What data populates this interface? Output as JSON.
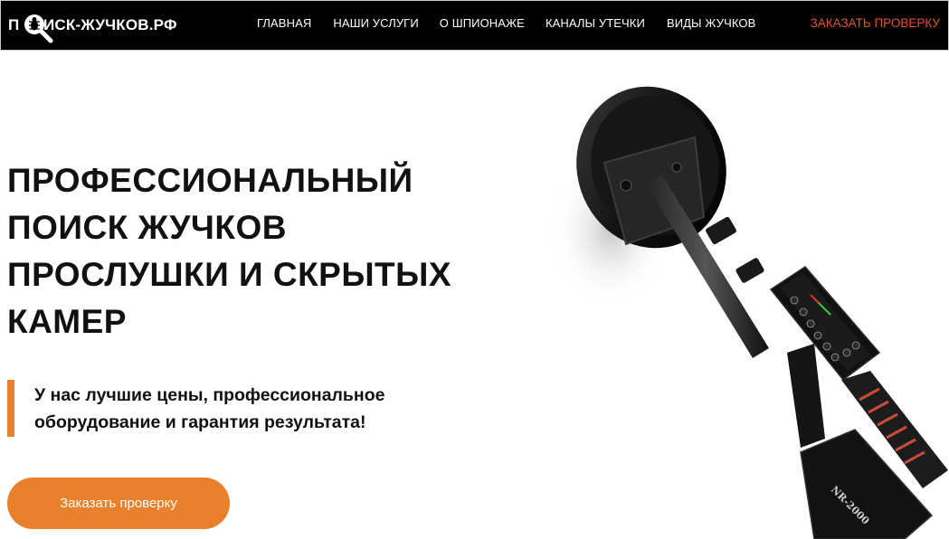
{
  "header": {
    "logo_text": "ПОИСК-ЖУЧКОВ.РФ",
    "logo_first": "П",
    "logo_rest": "ИСК-ЖУЧКОВ.РФ",
    "nav": [
      {
        "label": "ГЛАВНАЯ"
      },
      {
        "label": "НАШИ УСЛУГИ"
      },
      {
        "label": "О ШПИОНАЖЕ"
      },
      {
        "label": "КАНАЛЫ УТЕЧКИ"
      },
      {
        "label": "ВИДЫ ЖУЧКОВ"
      }
    ],
    "cta_label": "ЗАКАЗАТЬ ПРОВЕРКУ"
  },
  "hero": {
    "title_lines": [
      "ПРОФЕССИОНАЛЬНЫЙ",
      "ПОИСК ЖУЧКОВ",
      "ПРОСЛУШКИ И СКРЫТЫХ",
      "КАМЕР"
    ],
    "subtitle_lines": [
      "У нас лучшие цены, профессиональное",
      "оборудование и гарантия результата!"
    ],
    "button_label": "Заказать проверку"
  },
  "product_image": {
    "device_label": "NR-2000",
    "icon": "nonlinear-junction-detector"
  },
  "colors": {
    "header_bg": "#000000",
    "accent_orange": "#e8802c",
    "nav_cta_red": "#e8502c",
    "text_dark": "#111111"
  }
}
